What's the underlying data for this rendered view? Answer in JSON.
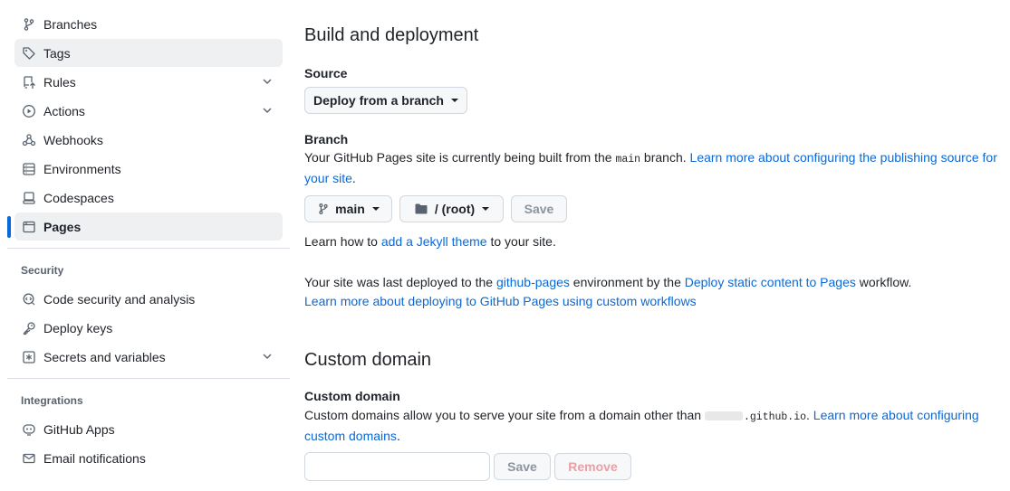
{
  "sidebar": {
    "items": [
      {
        "label": "Branches",
        "icon": "git-branch-icon"
      },
      {
        "label": "Tags",
        "icon": "tag-icon"
      },
      {
        "label": "Rules",
        "icon": "repo-push-icon"
      },
      {
        "label": "Actions",
        "icon": "play-icon"
      },
      {
        "label": "Webhooks",
        "icon": "webhook-icon"
      },
      {
        "label": "Environments",
        "icon": "server-icon"
      },
      {
        "label": "Codespaces",
        "icon": "codespaces-icon"
      },
      {
        "label": "Pages",
        "icon": "browser-icon"
      }
    ],
    "security_heading": "Security",
    "security_items": [
      {
        "label": "Code security and analysis",
        "icon": "codescan-icon"
      },
      {
        "label": "Deploy keys",
        "icon": "key-icon"
      },
      {
        "label": "Secrets and variables",
        "icon": "key-asterisk-icon"
      }
    ],
    "integrations_heading": "Integrations",
    "integrations_items": [
      {
        "label": "GitHub Apps",
        "icon": "apps-icon"
      },
      {
        "label": "Email notifications",
        "icon": "mail-icon"
      }
    ]
  },
  "build": {
    "title": "Build and deployment",
    "source_label": "Source",
    "source_value": "Deploy from a branch",
    "branch_label": "Branch",
    "branch_text_1": "Your GitHub Pages site is currently being built from the ",
    "branch_code": "main",
    "branch_text_2": " branch. ",
    "branch_link": "Learn more about configuring the publishing source for",
    "branch_link_2": "your site",
    "branch_text_3": ".",
    "branch_select": "main",
    "folder_select": "/ (root)",
    "save_label": "Save",
    "jekyll_text_1": "Learn how to ",
    "jekyll_link": "add a Jekyll theme",
    "jekyll_text_2": " to your site.",
    "deployed_text_1": "Your site was last deployed to the ",
    "deployed_link_env": "github-pages",
    "deployed_text_2": " environment by the ",
    "deployed_link_workflow": "Deploy static content to Pages",
    "deployed_text_3": " workflow.",
    "custom_workflows_link": "Learn more about deploying to GitHub Pages using custom workflows"
  },
  "domain": {
    "title": "Custom domain",
    "label": "Custom domain",
    "text_1": "Custom domains allow you to serve your site from a domain other than ",
    "code": ".github.io",
    "text_2": ". ",
    "link_1": "Learn more about configuring",
    "link_2": "custom domains",
    "text_3": ".",
    "input_value": "",
    "save_label": "Save",
    "remove_label": "Remove"
  },
  "colors": {
    "accent": "#0969da",
    "selected_bar": "#0969da",
    "danger_disabled": "#e8a0a5"
  }
}
